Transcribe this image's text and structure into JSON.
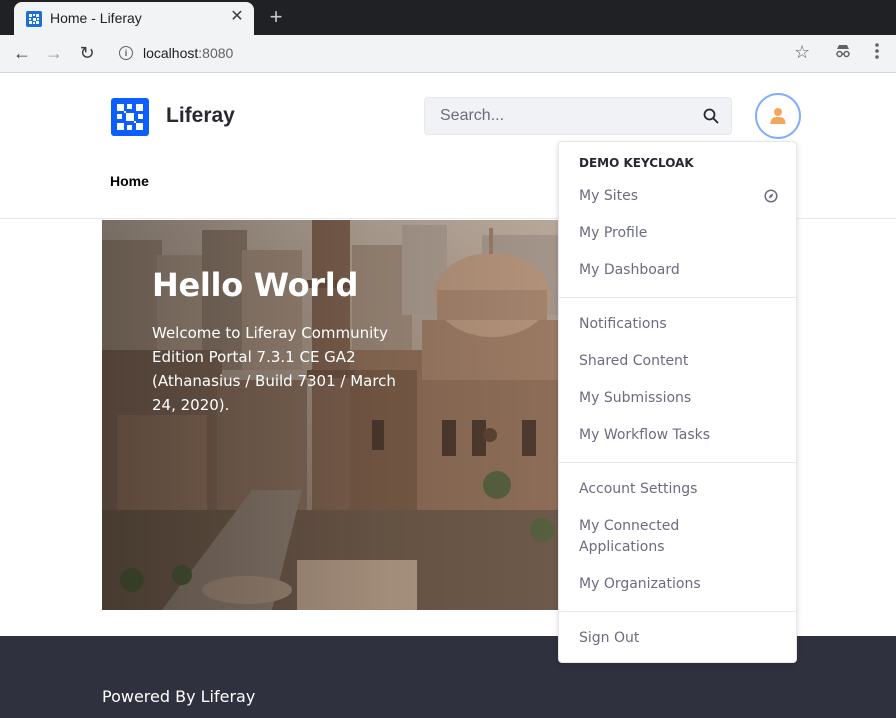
{
  "browser": {
    "tab_title": "Home - Liferay",
    "close_glyph": "✕",
    "new_tab_glyph": "+",
    "url_host": "localhost",
    "url_port": ":8080",
    "back_glyph": "←",
    "forward_glyph": "→",
    "reload_glyph": "↻",
    "star_glyph": "☆",
    "incognito_glyph": "⛓"
  },
  "header": {
    "site_name": "Liferay",
    "search_placeholder": "Search...",
    "brand_color": "#0b5fff",
    "avatar_color": "#f5a65b"
  },
  "nav": {
    "items": [
      {
        "label": "Home"
      }
    ]
  },
  "hero": {
    "title": "Hello World",
    "text": "Welcome to Liferay Community Edition Portal 7.3.1 CE GA2 (Athanasius / Build 7301 / March 24, 2020)."
  },
  "user_menu": {
    "header": "DEMO KEYCLOAK",
    "items": [
      {
        "label": "My Sites"
      },
      {
        "label": "My Profile"
      },
      {
        "label": "My Dashboard"
      },
      {
        "label": "Notifications"
      },
      {
        "label": "Shared Content"
      },
      {
        "label": "My Submissions"
      },
      {
        "label": "My Workflow Tasks"
      },
      {
        "label": "Account Settings"
      },
      {
        "label": "My Connected Applications"
      },
      {
        "label": "My Organizations"
      },
      {
        "label": "Sign Out"
      }
    ]
  },
  "footer": {
    "text": "Powered By Liferay",
    "background": "#30313f"
  }
}
